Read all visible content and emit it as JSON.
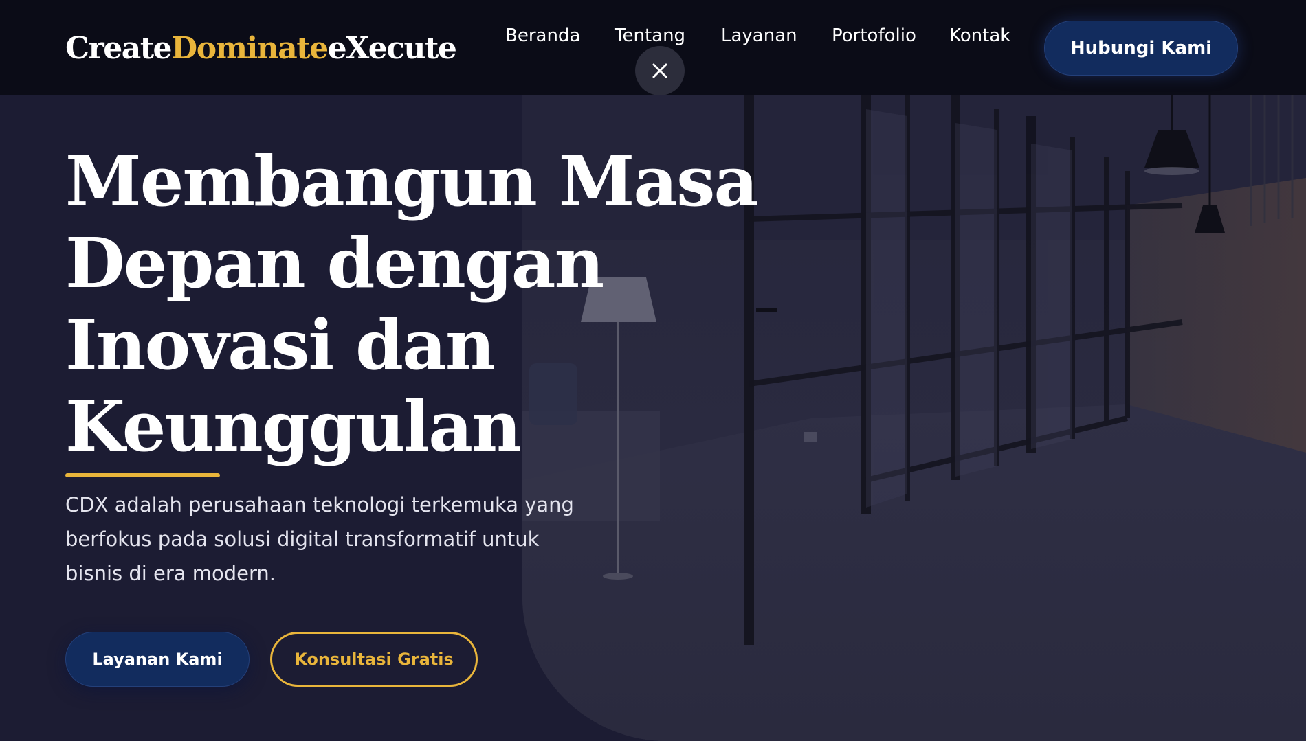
{
  "logo": {
    "part1": "Create",
    "part2": "Dominate",
    "part3": "eXecute"
  },
  "nav": {
    "items": [
      {
        "label": "Beranda"
      },
      {
        "label": "Tentang"
      },
      {
        "label": "Layanan"
      },
      {
        "label": "Portofolio"
      },
      {
        "label": "Kontak"
      }
    ],
    "cta_label": "Hubungi Kami",
    "close_icon": "close-icon"
  },
  "hero": {
    "title_lines": [
      "Membangun Masa",
      "Depan dengan",
      "Inovasi dan",
      "Keunggulan"
    ],
    "description_lines": [
      "CDX adalah perusahaan teknologi terkemuka yang",
      "berfokus pada solusi digital transformatif untuk",
      "bisnis di era modern."
    ],
    "primary_button": "Layanan Kami",
    "secondary_button": "Konsultasi Gratis"
  },
  "colors": {
    "background": "#1c1c33",
    "navbar": "#0b0c17",
    "accent_gold": "#e9b53b",
    "button_navy": "#122c5e",
    "text_white": "#ffffff"
  }
}
